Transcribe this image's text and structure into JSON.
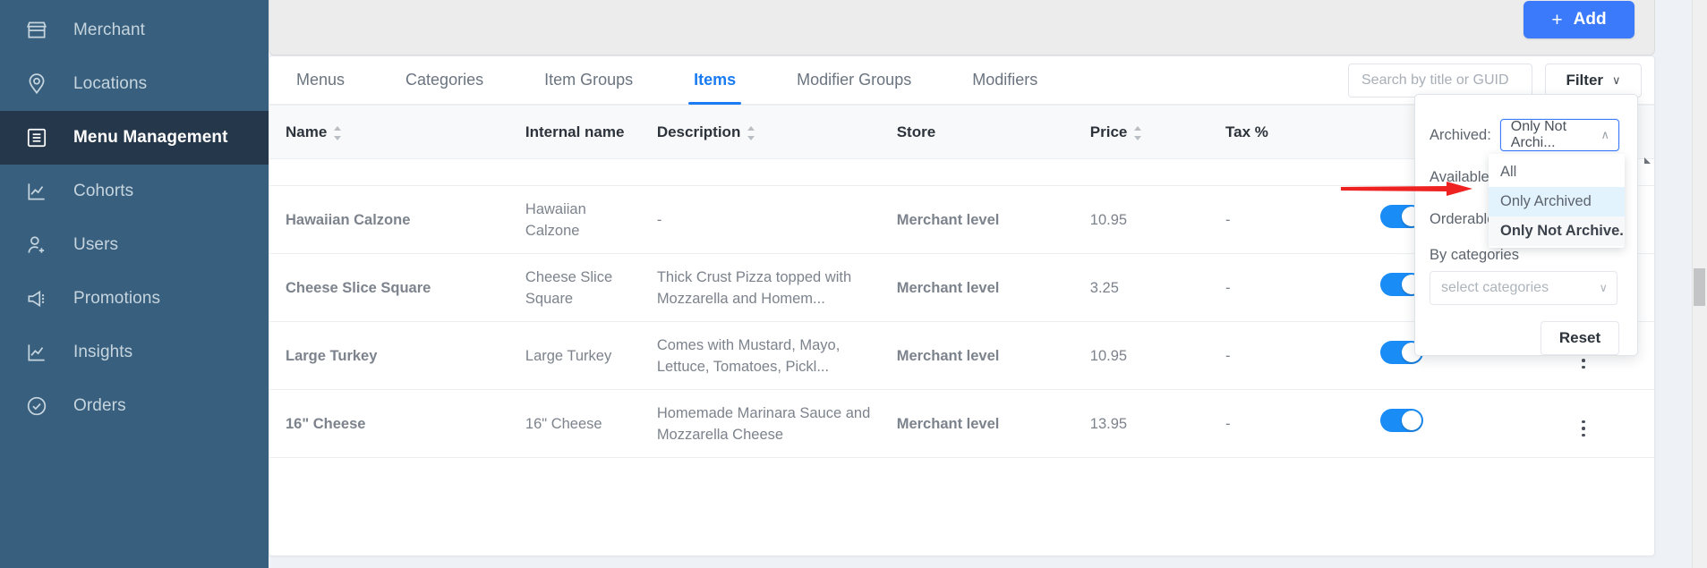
{
  "sidebar": {
    "items": [
      {
        "label": "Merchant",
        "icon": "store-icon",
        "active": false
      },
      {
        "label": "Locations",
        "icon": "location-pin-icon",
        "active": false
      },
      {
        "label": "Menu Management",
        "icon": "list-icon",
        "active": true
      },
      {
        "label": "Cohorts",
        "icon": "chart-line-icon",
        "active": false
      },
      {
        "label": "Users",
        "icon": "user-add-icon",
        "active": false
      },
      {
        "label": "Promotions",
        "icon": "megaphone-icon",
        "active": false
      },
      {
        "label": "Insights",
        "icon": "chart-line-icon",
        "active": false
      },
      {
        "label": "Orders",
        "icon": "check-circle-icon",
        "active": false
      }
    ]
  },
  "topbar": {
    "add_label": "Add",
    "add_plus": "+",
    "add_color": "#3b7bfb"
  },
  "tabs": [
    {
      "label": "Menus",
      "active": false
    },
    {
      "label": "Categories",
      "active": false
    },
    {
      "label": "Item Groups",
      "active": false
    },
    {
      "label": "Items",
      "active": true
    },
    {
      "label": "Modifier Groups",
      "active": false
    },
    {
      "label": "Modifiers",
      "active": false
    }
  ],
  "search": {
    "placeholder": "Search by title or GUID",
    "value": "",
    "icon": "search-icon"
  },
  "filter_button": {
    "label": "Filter",
    "caret": "∨"
  },
  "table": {
    "columns": [
      {
        "label": "Name",
        "sortable": true
      },
      {
        "label": "Internal name",
        "sortable": false
      },
      {
        "label": "Description",
        "sortable": true
      },
      {
        "label": "Store",
        "sortable": false
      },
      {
        "label": "Price",
        "sortable": true
      },
      {
        "label": "Tax %",
        "sortable": false
      },
      {
        "label": "",
        "sortable": false
      },
      {
        "label": "",
        "sortable": false
      }
    ],
    "rows": [
      {
        "name": "Hawaiian Calzone",
        "internal_name": "Hawaiian Calzone",
        "description": "-",
        "store": "Merchant level",
        "price": "10.95",
        "tax": "-",
        "toggle_on": true,
        "kebab": "more-vertical-icon"
      },
      {
        "name": "Cheese Slice Square",
        "internal_name": "Cheese Slice Square",
        "description": "Thick Crust Pizza topped with Mozzarella and Homem...",
        "store": "Merchant level",
        "price": "3.25",
        "tax": "-",
        "toggle_on": true,
        "kebab": "more-vertical-icon"
      },
      {
        "name": "Large Turkey",
        "internal_name": "Large Turkey",
        "description": "Comes with Mustard, Mayo, Lettuce, Tomatoes, Pickl...",
        "store": "Merchant level",
        "price": "10.95",
        "tax": "-",
        "toggle_on": true,
        "kebab": "more-vertical-icon"
      },
      {
        "name": "16\" Cheese",
        "internal_name": "16\" Cheese",
        "description": "Homemade Marinara Sauce and Mozzarella Cheese",
        "store": "Merchant level",
        "price": "13.95",
        "tax": "-",
        "toggle_on": true,
        "kebab": "more-vertical-icon"
      }
    ]
  },
  "filter_panel": {
    "archived_label": "Archived:",
    "archived_value": "Only Not Archi...",
    "archived_caret": "∧",
    "available_label": "Available:",
    "orderable_label": "Orderable:",
    "by_categories_label": "By categories",
    "categories_placeholder": "select categories",
    "categories_caret": "∨",
    "reset_label": "Reset",
    "options": [
      {
        "label": "All",
        "state": "normal"
      },
      {
        "label": "Only Archived",
        "state": "highlighted"
      },
      {
        "label": "Only Not Archive...",
        "state": "selected"
      }
    ]
  },
  "annotation": {
    "shape": "red-arrow",
    "color": "#ef2222",
    "points_to": "Only Archived"
  }
}
